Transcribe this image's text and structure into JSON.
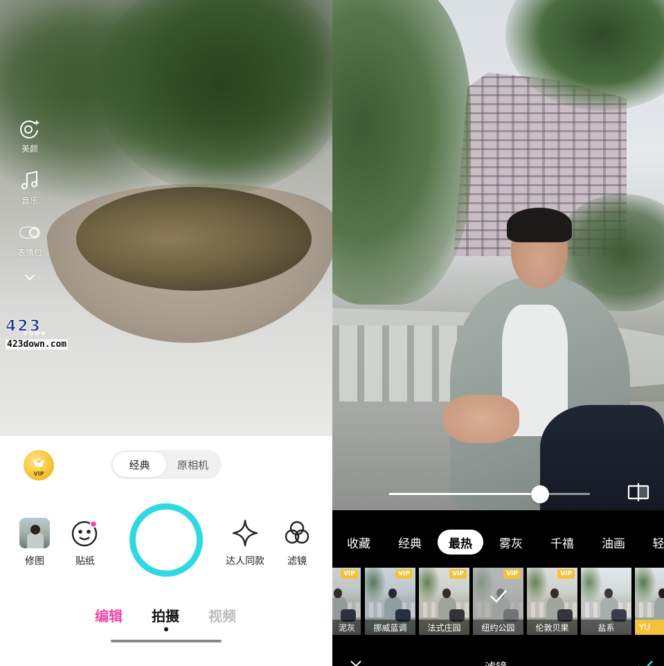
{
  "camera": {
    "side_tools": [
      {
        "label": "美颜",
        "icon": "beauty-camera-icon"
      },
      {
        "label": "音乐",
        "icon": "music-note-icon"
      },
      {
        "label": "表情包",
        "icon": "toggle-icon"
      }
    ],
    "more_icon": "chevron-down-icon",
    "watermark": {
      "big": "423",
      "small_top": "DOWN",
      "small": "423down.com"
    },
    "vip_badge": "VIP",
    "mode_switch": {
      "options": [
        "经典",
        "原相机"
      ],
      "selected": "经典"
    },
    "tools": {
      "retouch": "修图",
      "sticker": "贴纸",
      "same_style": "达人同款",
      "filter": "滤镜"
    },
    "bottom_tabs": {
      "edit": "编辑",
      "shoot": "拍摄",
      "video": "视频",
      "active": "拍摄"
    },
    "colors": {
      "shutter": "#2fd9e1",
      "edit_accent": "#f046a8",
      "sticker_dot": "#f046a8"
    }
  },
  "editor": {
    "intensity": 0.75,
    "compare_icon": "compare-icon",
    "categories": [
      "收藏",
      "经典",
      "最热",
      "雾灰",
      "千禧",
      "油画",
      "轻"
    ],
    "active_category": "最热",
    "filters": [
      {
        "label": "泥灰",
        "vip": "VIP",
        "selected": false
      },
      {
        "label": "挪威蓝调",
        "vip": "VIP",
        "selected": false
      },
      {
        "label": "法式庄园",
        "vip": "VIP",
        "selected": false
      },
      {
        "label": "纽约公园",
        "vip": "VIP",
        "selected": true
      },
      {
        "label": "伦敦贝果",
        "vip": "VIP",
        "selected": false
      },
      {
        "label": "盐系",
        "vip": "",
        "selected": false
      },
      {
        "label": "YU",
        "vip": "",
        "selected": false
      }
    ],
    "footer": {
      "title": "滤镜",
      "close_icon": "close-icon",
      "confirm_icon": "check-icon"
    },
    "colors": {
      "vip_tag": "#f2c33a",
      "yu_label": "#f2c33a"
    }
  }
}
